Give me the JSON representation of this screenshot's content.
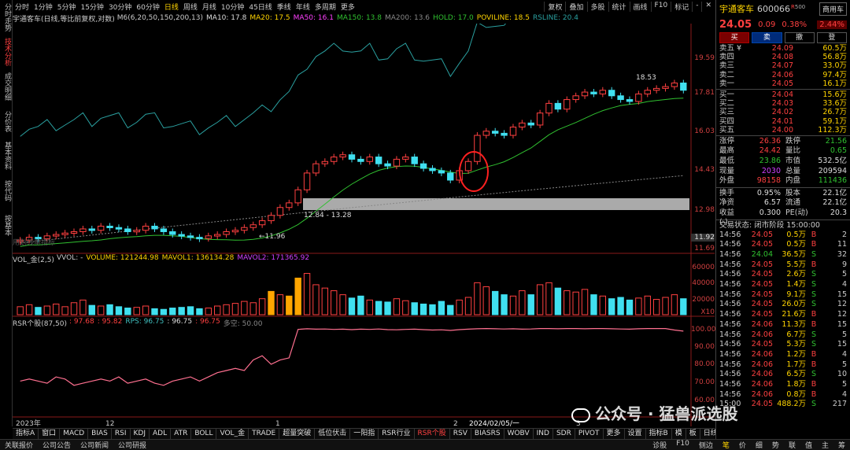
{
  "left_rail": [
    "分时走势",
    "技术分析",
    "成交明细",
    "分价表",
    "基本资料",
    "按代码",
    "按基本"
  ],
  "toolbar": {
    "periods": [
      "分时",
      "1分钟",
      "5分钟",
      "15分钟",
      "30分钟",
      "60分钟",
      "日线",
      "周线",
      "月线",
      "10分钟",
      "45日线",
      "季线",
      "年线",
      "多周期",
      "更多"
    ],
    "active_period": "日线",
    "right_items": [
      "复权",
      "叠加",
      "多股",
      "统计",
      "画线",
      "F10",
      "标记",
      "-",
      "✕"
    ]
  },
  "title_line": {
    "stock": "宇通客车(日线,等比前复权,对数)",
    "items": [
      {
        "text": "M6(6,20,50,150,200,13)",
        "color": "#cccccc"
      },
      {
        "text": "MA10: 17.8",
        "color": "#dddddd"
      },
      {
        "text": "MA20: 17.5",
        "color": "#ffd400"
      },
      {
        "text": "MA50: 16.1",
        "color": "#ff40ff"
      },
      {
        "text": "MA150: 13.8",
        "color": "#30c030"
      },
      {
        "text": "MA200: 13.6",
        "color": "#888888"
      },
      {
        "text": "HOLD: 17.0",
        "color": "#30c030"
      },
      {
        "text": "POVILINE: 18.5",
        "color": "#ffd400"
      },
      {
        "text": "RSLINE: 20.4",
        "color": "#2aa0a0"
      }
    ]
  },
  "price_axis": [
    "19.59",
    "17.81",
    "16.03",
    "14.43",
    "12.98",
    "11.92",
    "11.69"
  ],
  "vol_axis": [
    "60000",
    "40000",
    "20000",
    "X10"
  ],
  "rsr_axis": [
    "100.00",
    "90.00",
    "80.00",
    "70.00",
    "60.00"
  ],
  "vol_title": {
    "name": "VOL_金(2,5)",
    "items": [
      {
        "text": "VVOL: -",
        "color": "#cccccc"
      },
      {
        "text": "VOLUME: 121244.98",
        "color": "#ffd400"
      },
      {
        "text": "MAVOL1: 136134.28",
        "color": "#ffd400"
      },
      {
        "text": "MAVOL2: 171365.92",
        "color": "#d040ff"
      }
    ]
  },
  "rsr_title": {
    "name": "RSR个股(87,50)",
    "items": [
      {
        "text": ": 97.68",
        "color": "#ff4040"
      },
      {
        "text": ": 95.82",
        "color": "#ff4040"
      },
      {
        "text": "RPS: 96.75",
        "color": "#40c0c0"
      },
      {
        "text": ": 96.75",
        "color": "#dddddd"
      },
      {
        "text": ": 96.75",
        "color": "#ff4040"
      },
      {
        "text": "多空: 50.00",
        "color": "#888888"
      }
    ]
  },
  "annotations": {
    "range_label": "12.84 - 13.28",
    "low_label": "←11.96",
    "high_label": "18.53",
    "faint_text": "用划线单指标"
  },
  "date_axis": [
    "2023年",
    "12",
    "1",
    "2",
    "2024/02/05/一",
    "3"
  ],
  "bottom_tabs": [
    "指标A",
    "窗口",
    "MACD",
    "BIAS",
    "RSI",
    "KDJ",
    "ADL",
    "ATR",
    "BOLL",
    "VOL_金",
    "TRADE",
    "超量突破",
    "低位伏击",
    "一阳指",
    "RSR行业",
    "RSR个股",
    "RSV",
    "BIASRS",
    "WOBV",
    "IND",
    "SDR",
    "PIVOT",
    "更多",
    "设置"
  ],
  "bottom_tabs_active": "RSR个股",
  "bottom_tabs_right": [
    "指标B",
    "模",
    "板",
    "日线"
  ],
  "status_bar": {
    "left": [
      "关联报价",
      "公司公告",
      "公司新闻",
      "公司研报"
    ],
    "right": [
      "诊股",
      "F10",
      "侧边",
      "笔",
      "价",
      "细",
      "势",
      "联",
      "值",
      "主",
      "筹"
    ]
  },
  "right_panel": {
    "name": "宇通客车",
    "code": "600066",
    "r": "R",
    "code_suffix": "500",
    "tag": "商用车",
    "price": "24.05",
    "change": "0.09",
    "pct": "0.38%",
    "pct_box": "2.44%",
    "buttons": [
      "买",
      "卖",
      "撤",
      "登"
    ],
    "sell": [
      {
        "label": "卖五 ¥",
        "price": "24.09",
        "vol": "60.5万"
      },
      {
        "label": "卖四",
        "price": "24.08",
        "vol": "56.8万"
      },
      {
        "label": "卖三",
        "price": "24.07",
        "vol": "33.0万"
      },
      {
        "label": "卖二",
        "price": "24.06",
        "vol": "97.4万"
      },
      {
        "label": "卖一",
        "price": "24.05",
        "vol": "16.1万"
      }
    ],
    "buy": [
      {
        "label": "买一",
        "price": "24.04",
        "vol": "15.6万"
      },
      {
        "label": "买二",
        "price": "24.03",
        "vol": "33.6万"
      },
      {
        "label": "买三",
        "price": "24.02",
        "vol": "26.7万"
      },
      {
        "label": "买四",
        "price": "24.01",
        "vol": "59.1万"
      },
      {
        "label": "买五",
        "price": "24.00",
        "vol": "112.3万"
      }
    ],
    "stats": [
      {
        "k": "涨停",
        "v": "26.36",
        "vc": "red",
        "k2": "跌停",
        "v2": "21.56",
        "v2c": "green"
      },
      {
        "k": "最高",
        "v": "24.42",
        "vc": "red",
        "k2": "量比",
        "v2": "0.65",
        "v2c": "green"
      },
      {
        "k": "最低",
        "v": "23.86",
        "vc": "green",
        "k2": "市值",
        "v2": "532.5亿",
        "v2c": "white"
      },
      {
        "k": "现量",
        "v": "2030",
        "vc": "purple",
        "k2": "总量",
        "v2": "209594",
        "v2c": "white"
      },
      {
        "k": "外盘",
        "v": "98158",
        "vc": "red",
        "k2": "内盘",
        "v2": "111436",
        "v2c": "green"
      }
    ],
    "stats2": [
      {
        "k": "换手",
        "v": "0.95%",
        "vc": "white",
        "k2": "股本",
        "v2": "22.1亿",
        "v2c": "white"
      },
      {
        "k": "净资",
        "v": "6.57",
        "vc": "white",
        "k2": "流通",
        "v2": "22.1亿",
        "v2c": "white"
      },
      {
        "k": "收益(-)",
        "v": "0.300",
        "vc": "white",
        "k2": "PE(动)",
        "v2": "20.3",
        "v2c": "white"
      }
    ],
    "trade_state": "交易状态: 闭市阶段 15:00:00",
    "trades": [
      {
        "t": "14:56",
        "p": "24.05",
        "v": "0.5万",
        "s": "B",
        "n": "2"
      },
      {
        "t": "14:56",
        "p": "24.05",
        "v": "0.5万",
        "s": "B",
        "n": "11"
      },
      {
        "t": "14:56",
        "p": "24.04",
        "v": "36.5万",
        "s": "S",
        "n": "32"
      },
      {
        "t": "14:56",
        "p": "24.05",
        "v": "5.5万",
        "s": "B",
        "n": "9"
      },
      {
        "t": "14:56",
        "p": "24.05",
        "v": "2.6万",
        "s": "S",
        "n": "5"
      },
      {
        "t": "14:56",
        "p": "24.05",
        "v": "1.4万",
        "s": "S",
        "n": "4"
      },
      {
        "t": "14:56",
        "p": "24.05",
        "v": "9.1万",
        "s": "S",
        "n": "15"
      },
      {
        "t": "14:56",
        "p": "24.05",
        "v": "26.0万",
        "s": "S",
        "n": "12"
      },
      {
        "t": "14:56",
        "p": "24.05",
        "v": "21.6万",
        "s": "B",
        "n": "12"
      },
      {
        "t": "14:56",
        "p": "24.06",
        "v": "11.3万",
        "s": "B",
        "n": "15"
      },
      {
        "t": "14:56",
        "p": "24.06",
        "v": "6.7万",
        "s": "S",
        "n": "5"
      },
      {
        "t": "14:56",
        "p": "24.05",
        "v": "5.3万",
        "s": "S",
        "n": "15"
      },
      {
        "t": "14:56",
        "p": "24.06",
        "v": "1.2万",
        "s": "B",
        "n": "4"
      },
      {
        "t": "14:56",
        "p": "24.06",
        "v": "1.7万",
        "s": "B",
        "n": "5"
      },
      {
        "t": "14:56",
        "p": "24.06",
        "v": "6.5万",
        "s": "S",
        "n": "10"
      },
      {
        "t": "14:56",
        "p": "24.06",
        "v": "1.8万",
        "s": "B",
        "n": "5"
      },
      {
        "t": "14:56",
        "p": "24.06",
        "v": "0.8万",
        "s": "B",
        "n": "4"
      },
      {
        "t": "15:00",
        "p": "24.05",
        "v": "488.2万",
        "s": "S",
        "n": "217"
      }
    ]
  },
  "watermark": "公众号 · 猛兽派选股",
  "chart_data": {
    "type": "candlestick",
    "closes": [
      11.9,
      12.0,
      11.95,
      12.05,
      12.1,
      12.15,
      12.2,
      12.3,
      12.25,
      12.4,
      12.35,
      12.3,
      12.2,
      12.25,
      12.4,
      12.3,
      12.2,
      12.1,
      12.05,
      12.0,
      11.96,
      12.05,
      12.1,
      12.2,
      12.25,
      12.35,
      12.45,
      12.6,
      12.8,
      13.1,
      13.28,
      13.8,
      14.5,
      14.9,
      15.0,
      15.2,
      15.3,
      15.1,
      15.0,
      15.2,
      14.9,
      14.8,
      15.1,
      15.2,
      14.9,
      14.7,
      14.6,
      14.5,
      14.2,
      14.6,
      15.0,
      16.2,
      16.4,
      16.3,
      16.2,
      16.6,
      16.8,
      16.7,
      17.3,
      17.8,
      17.5,
      18.0,
      18.2,
      18.4,
      18.3,
      18.5,
      18.2,
      18.0,
      17.9,
      18.3,
      18.5,
      18.6,
      18.7,
      18.9,
      18.5
    ],
    "volumes": [
      12000,
      15000,
      11000,
      13000,
      16000,
      12000,
      18000,
      22000,
      14000,
      13000,
      15000,
      12000,
      10000,
      11000,
      13000,
      9000,
      8000,
      10000,
      11000,
      12000,
      9000,
      10000,
      13000,
      15000,
      17000,
      20000,
      18000,
      24000,
      35000,
      30000,
      28000,
      55000,
      62000,
      45000,
      40000,
      36000,
      30000,
      25000,
      28000,
      22000,
      20000,
      19000,
      24000,
      21000,
      18000,
      16000,
      15000,
      20000,
      14000,
      22000,
      26000,
      48000,
      42000,
      35000,
      30000,
      28000,
      36000,
      30000,
      45000,
      48000,
      40000,
      36000,
      34000,
      38000,
      30000,
      28000,
      24000,
      26000,
      22000,
      25000,
      28000,
      23000,
      26000,
      30000,
      24000
    ],
    "rsr": [
      74,
      75,
      74,
      73,
      76,
      75,
      72,
      73,
      74,
      75,
      74,
      76,
      73,
      74,
      75,
      73,
      72,
      74,
      75,
      76,
      74,
      76,
      78,
      79,
      80,
      79,
      84,
      86,
      82,
      84,
      85,
      98.5,
      98.8,
      98.6,
      98.7,
      98.5,
      98.6,
      98.4,
      98.6,
      98.5,
      98.7,
      98.4,
      98.3,
      98.5,
      98.6,
      98.4,
      98.2,
      98.3,
      98.0,
      98.4,
      98.6,
      98.8,
      98.9,
      98.8,
      98.7,
      98.8,
      98.6,
      98.7,
      98.9,
      98.9,
      98.8,
      98.9,
      98.9,
      98.8,
      98.9,
      98.9,
      98.8,
      98.7,
      98.6,
      98.8,
      98.9,
      98.9,
      98.9,
      98.2,
      97.7
    ]
  }
}
